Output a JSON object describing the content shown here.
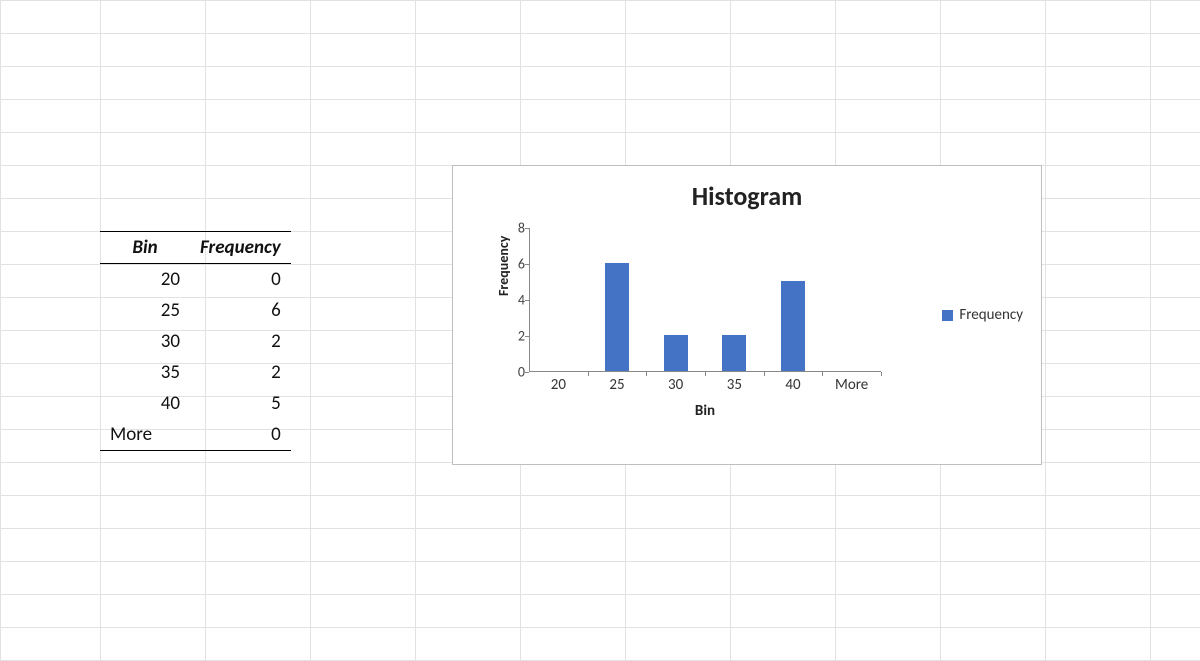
{
  "table": {
    "headers": {
      "bin": "Bin",
      "freq": "Frequency"
    },
    "rows": [
      {
        "bin": "20",
        "bin_align": "right",
        "freq": "0"
      },
      {
        "bin": "25",
        "bin_align": "right",
        "freq": "6"
      },
      {
        "bin": "30",
        "bin_align": "right",
        "freq": "2"
      },
      {
        "bin": "35",
        "bin_align": "right",
        "freq": "2"
      },
      {
        "bin": "40",
        "bin_align": "right",
        "freq": "5"
      },
      {
        "bin": "More",
        "bin_align": "left",
        "freq": "0"
      }
    ]
  },
  "chart": {
    "title": "Histogram",
    "xlabel": "Bin",
    "ylabel": "Frequency",
    "legend": "Frequency",
    "color": "#4472C4"
  },
  "chart_data": {
    "type": "bar",
    "categories": [
      "20",
      "25",
      "30",
      "35",
      "40",
      "More"
    ],
    "series": [
      {
        "name": "Frequency",
        "values": [
          0,
          6,
          2,
          2,
          5,
          0
        ]
      }
    ],
    "title": "Histogram",
    "xlabel": "Bin",
    "ylabel": "Frequency",
    "ylim": [
      0,
      8
    ],
    "yticks": [
      0,
      2,
      4,
      6,
      8
    ]
  }
}
